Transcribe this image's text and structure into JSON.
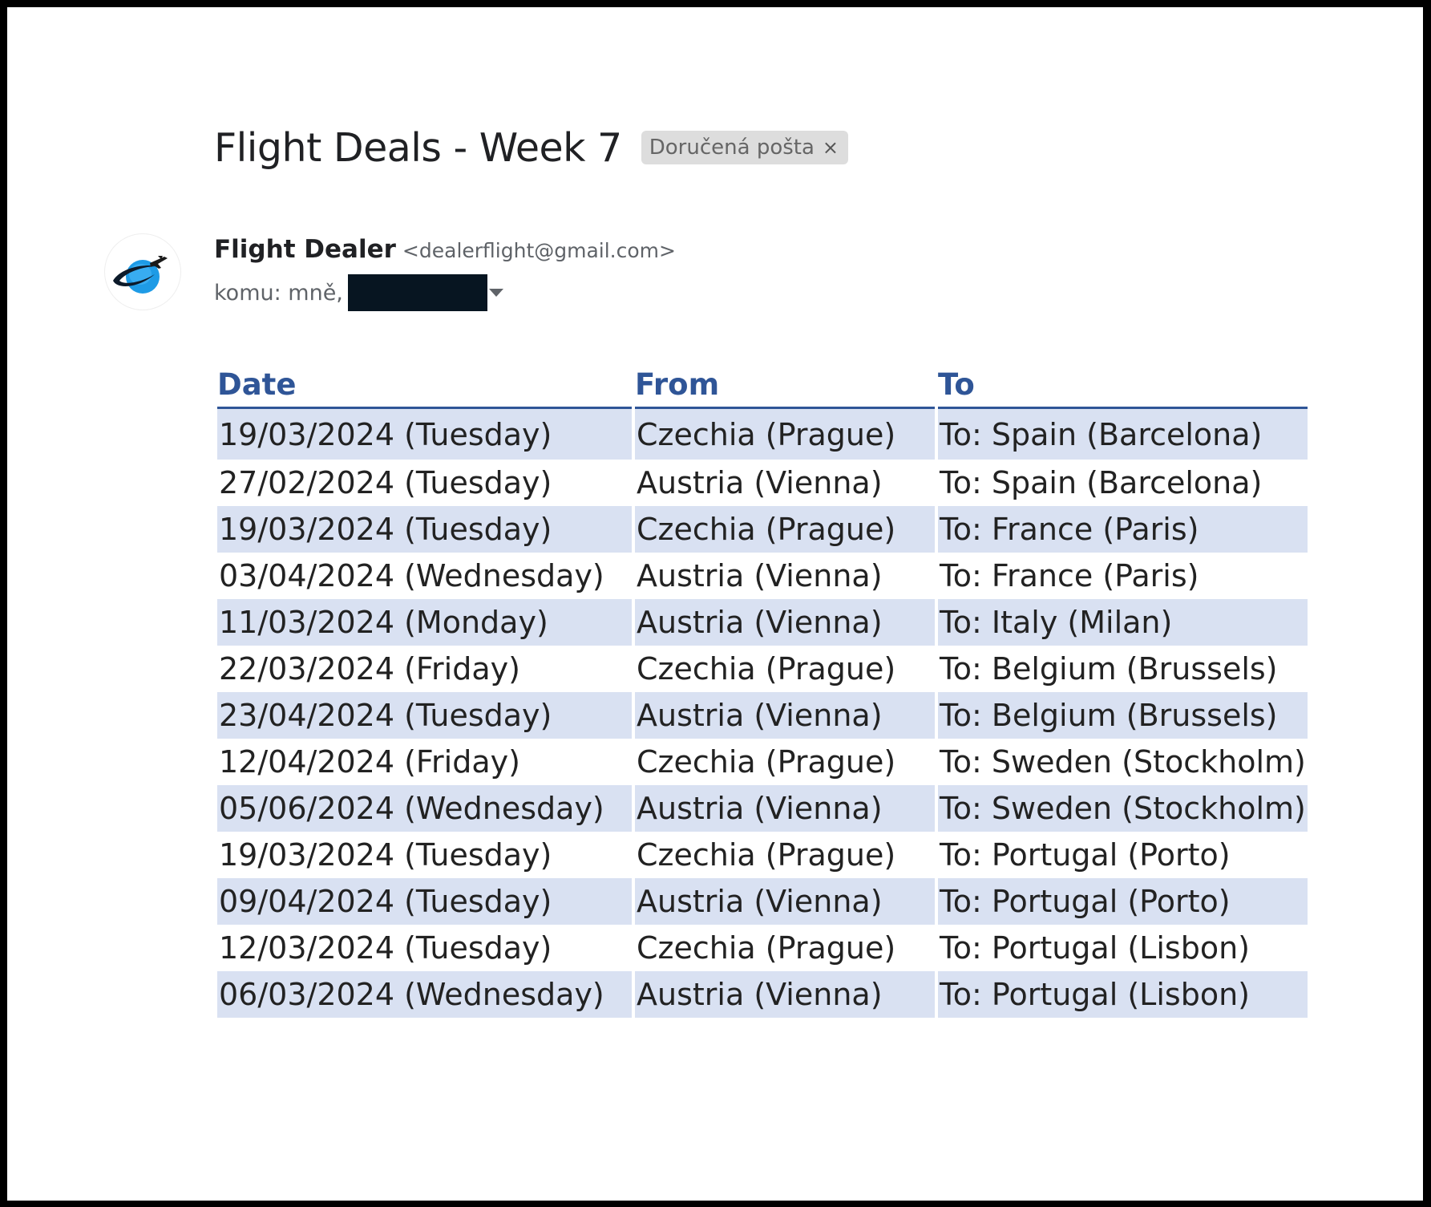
{
  "email": {
    "subject": "Flight Deals - Week 7",
    "label_chip": "Doručená pošta",
    "label_chip_close": "×",
    "sender_name": "Flight Dealer",
    "sender_email": "<dealerflight@gmail.com>",
    "recipient_prefix": "komu: mně,",
    "avatar_icon": "globe-airplane-logo-icon",
    "redaction_color": "#071521"
  },
  "table": {
    "headers": [
      "Date",
      "From",
      "To"
    ],
    "header_color": "#2f5597",
    "stripe_color": "#d9e1f2",
    "rows": [
      [
        "19/03/2024 (Tuesday)",
        "Czechia (Prague)",
        "To: Spain (Barcelona)"
      ],
      [
        "27/02/2024 (Tuesday)",
        "Austria (Vienna)",
        "To: Spain (Barcelona)"
      ],
      [
        "19/03/2024 (Tuesday)",
        "Czechia (Prague)",
        "To: France (Paris)"
      ],
      [
        "03/04/2024 (Wednesday)",
        "Austria (Vienna)",
        "To: France (Paris)"
      ],
      [
        "11/03/2024 (Monday)",
        "Austria (Vienna)",
        "To: Italy (Milan)"
      ],
      [
        "22/03/2024 (Friday)",
        "Czechia (Prague)",
        "To: Belgium (Brussels)"
      ],
      [
        "23/04/2024 (Tuesday)",
        "Austria (Vienna)",
        "To: Belgium (Brussels)"
      ],
      [
        "12/04/2024 (Friday)",
        "Czechia (Prague)",
        "To: Sweden (Stockholm)"
      ],
      [
        "05/06/2024 (Wednesday)",
        "Austria (Vienna)",
        "To: Sweden (Stockholm)"
      ],
      [
        "19/03/2024 (Tuesday)",
        "Czechia (Prague)",
        "To: Portugal (Porto)"
      ],
      [
        "09/04/2024 (Tuesday)",
        "Austria (Vienna)",
        "To: Portugal (Porto)"
      ],
      [
        "12/03/2024 (Tuesday)",
        "Czechia (Prague)",
        "To: Portugal (Lisbon)"
      ],
      [
        "06/03/2024 (Wednesday)",
        "Austria (Vienna)",
        "To: Portugal (Lisbon)"
      ]
    ]
  }
}
